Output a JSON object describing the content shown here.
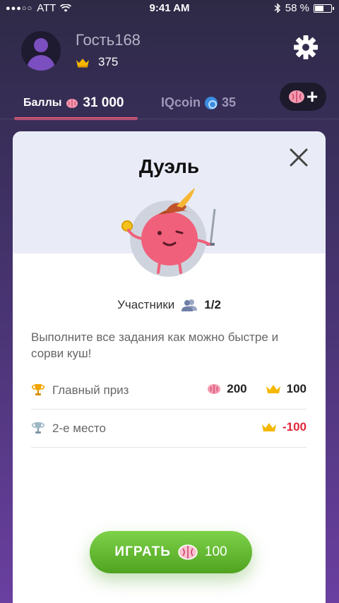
{
  "status_bar": {
    "signal": "●●●○○",
    "carrier": "ATT",
    "time": "9:41 AM",
    "battery": "58 %",
    "battery_level": 0.58,
    "icons": [
      "wifi-icon",
      "bluetooth-icon",
      "battery-icon"
    ]
  },
  "header": {
    "username": "Гость168",
    "crowns": "375",
    "icons": [
      "avatar-icon",
      "crown-icon",
      "gear-icon"
    ]
  },
  "tabs": {
    "points_label": "Баллы",
    "points_value": "31 000",
    "iqcoin_label": "IQcoin",
    "iqcoin_value": "35",
    "add_icon": "brain-plus-icon"
  },
  "card": {
    "title": "Дуэль",
    "participants_label": "Участники",
    "participants_value": "1/2",
    "description": "Выполните все задания как можно быстре и сорви куш!",
    "prizes": [
      {
        "label": "Главный приз",
        "brains": "200",
        "crowns": "100",
        "icon": "trophy-gold-icon"
      },
      {
        "label": "2-е место",
        "crowns": "-100",
        "icon": "trophy-silver-icon"
      }
    ],
    "play_label": "ИГРАТЬ",
    "play_cost": "100"
  },
  "colors": {
    "accent_pink": "#f05a7a",
    "play_green": "#5cb52a",
    "negative_red": "#e0263c",
    "crown_gold": "#f5b700",
    "coin_blue": "#3b8de0"
  }
}
